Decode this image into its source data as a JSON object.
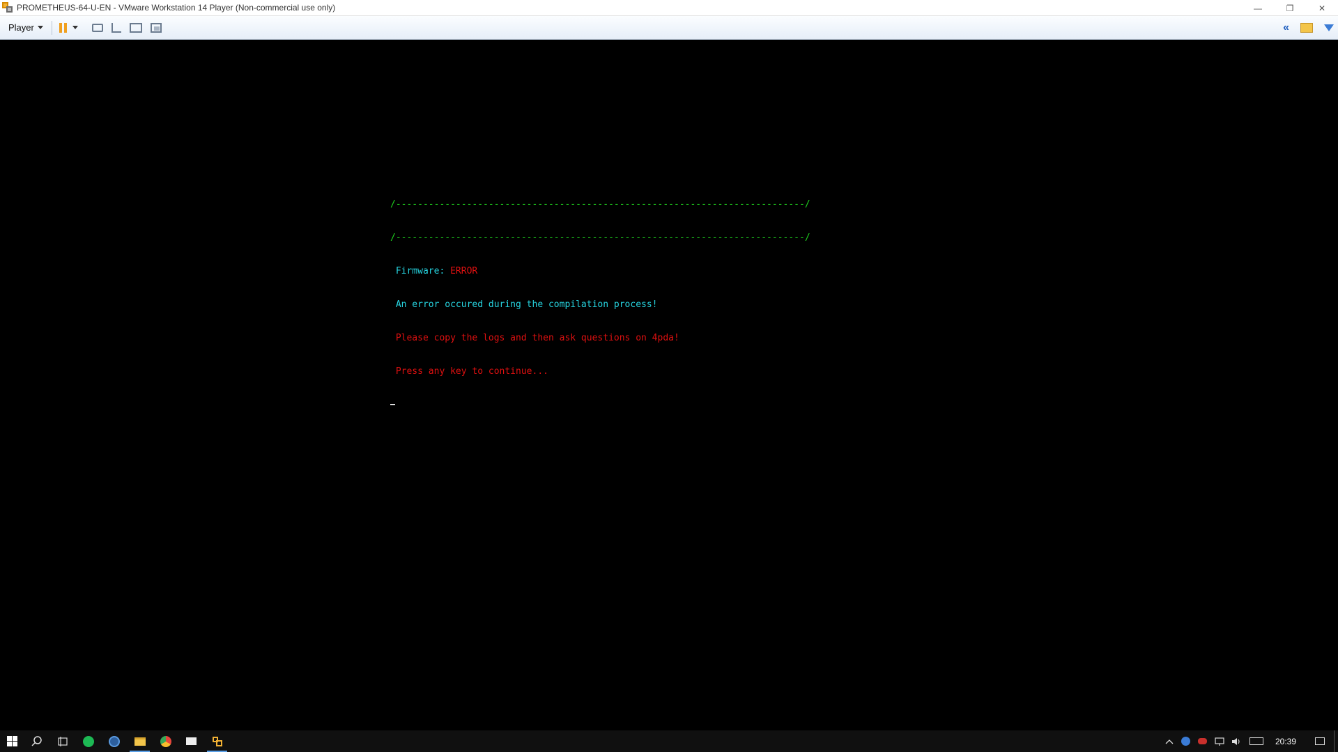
{
  "window": {
    "title": "PROMETHEUS-64-U-EN - VMware Workstation 14 Player (Non-commercial use only)",
    "controls": {
      "minimize": "—",
      "restore": "❐",
      "close": "✕"
    }
  },
  "toolbar": {
    "player_label": "Player",
    "icons": [
      "pause-icon",
      "devices-icon",
      "send-ctrl-alt-del-icon",
      "fullscreen-icon",
      "unity-icon"
    ],
    "right_icons": {
      "collapse": "«"
    }
  },
  "console": {
    "border_line_1": "/---------------------------------------------------------------------------/",
    "border_line_2": "/---------------------------------------------------------------------------/",
    "firmware_label": " Firmware: ",
    "firmware_status": "ERROR",
    "line_error": " An error occured during the compilation process!",
    "line_copy_logs": " Please copy the logs and then ask questions on 4pda!",
    "line_press_key": " Press any key to continue...",
    "colors": {
      "border": "#1fd51f",
      "info": "#26d4e0",
      "error": "#e01010"
    }
  },
  "taskbar": {
    "apps": [
      {
        "name": "start",
        "icon": "windows-logo-icon"
      },
      {
        "name": "search",
        "icon": "search-icon"
      },
      {
        "name": "task-view",
        "icon": "task-view-icon"
      },
      {
        "name": "spotify",
        "icon": "spotify-icon",
        "color": "#1db954"
      },
      {
        "name": "app-blue",
        "icon": "app-icon",
        "color": "#3a7bd5"
      },
      {
        "name": "file-explorer",
        "icon": "folder-icon",
        "color": "#f3c54a"
      },
      {
        "name": "chrome",
        "icon": "chrome-icon",
        "color": "#e8453c"
      },
      {
        "name": "mail",
        "icon": "mail-icon"
      },
      {
        "name": "vmware",
        "icon": "vmware-icon",
        "color": "#f2b134"
      }
    ],
    "tray": {
      "clock": "20:39"
    }
  }
}
